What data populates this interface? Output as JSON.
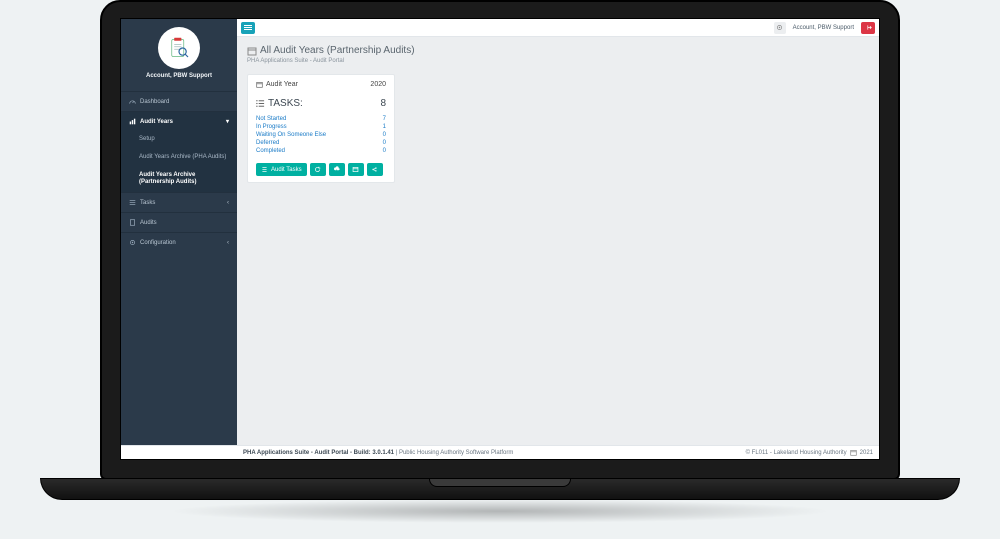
{
  "topbar": {
    "account_label": "Account, PBW Support"
  },
  "sidebar": {
    "account_name": "Account, PBW Support",
    "items": {
      "dashboard": "Dashboard",
      "audit_years": "Audit Years",
      "tasks": "Tasks",
      "audits": "Audits",
      "configuration": "Configuration"
    },
    "audit_years_sub": {
      "setup": "Setup",
      "archive_pha": "Audit Years Archive (PHA Audits)",
      "archive_partnership": "Audit Years Archive (Partnership Audits)"
    }
  },
  "page": {
    "title": "All Audit Years (Partnership Audits)",
    "subtitle": "PHA Applications Suite - Audit Portal"
  },
  "card": {
    "header_label": "Audit Year",
    "year": "2020",
    "tasks_label": "TASKS:",
    "tasks_total": "8",
    "rows": {
      "not_started_label": "Not Started",
      "not_started_val": "7",
      "in_progress_label": "In Progress",
      "in_progress_val": "1",
      "waiting_label": "Waiting On Someone Else",
      "waiting_val": "0",
      "deferred_label": "Deferred",
      "deferred_val": "0",
      "completed_label": "Completed",
      "completed_val": "0"
    },
    "actions": {
      "audit_tasks": "Audit Tasks"
    }
  },
  "footer": {
    "app_name": "PHA Applications Suite - Audit Portal - Build: 3.0.1.41",
    "divider": " | ",
    "platform": "Public Housing Authority Software Platform",
    "org": "© FL011 - Lakeland Housing Authority",
    "year": "2021"
  }
}
